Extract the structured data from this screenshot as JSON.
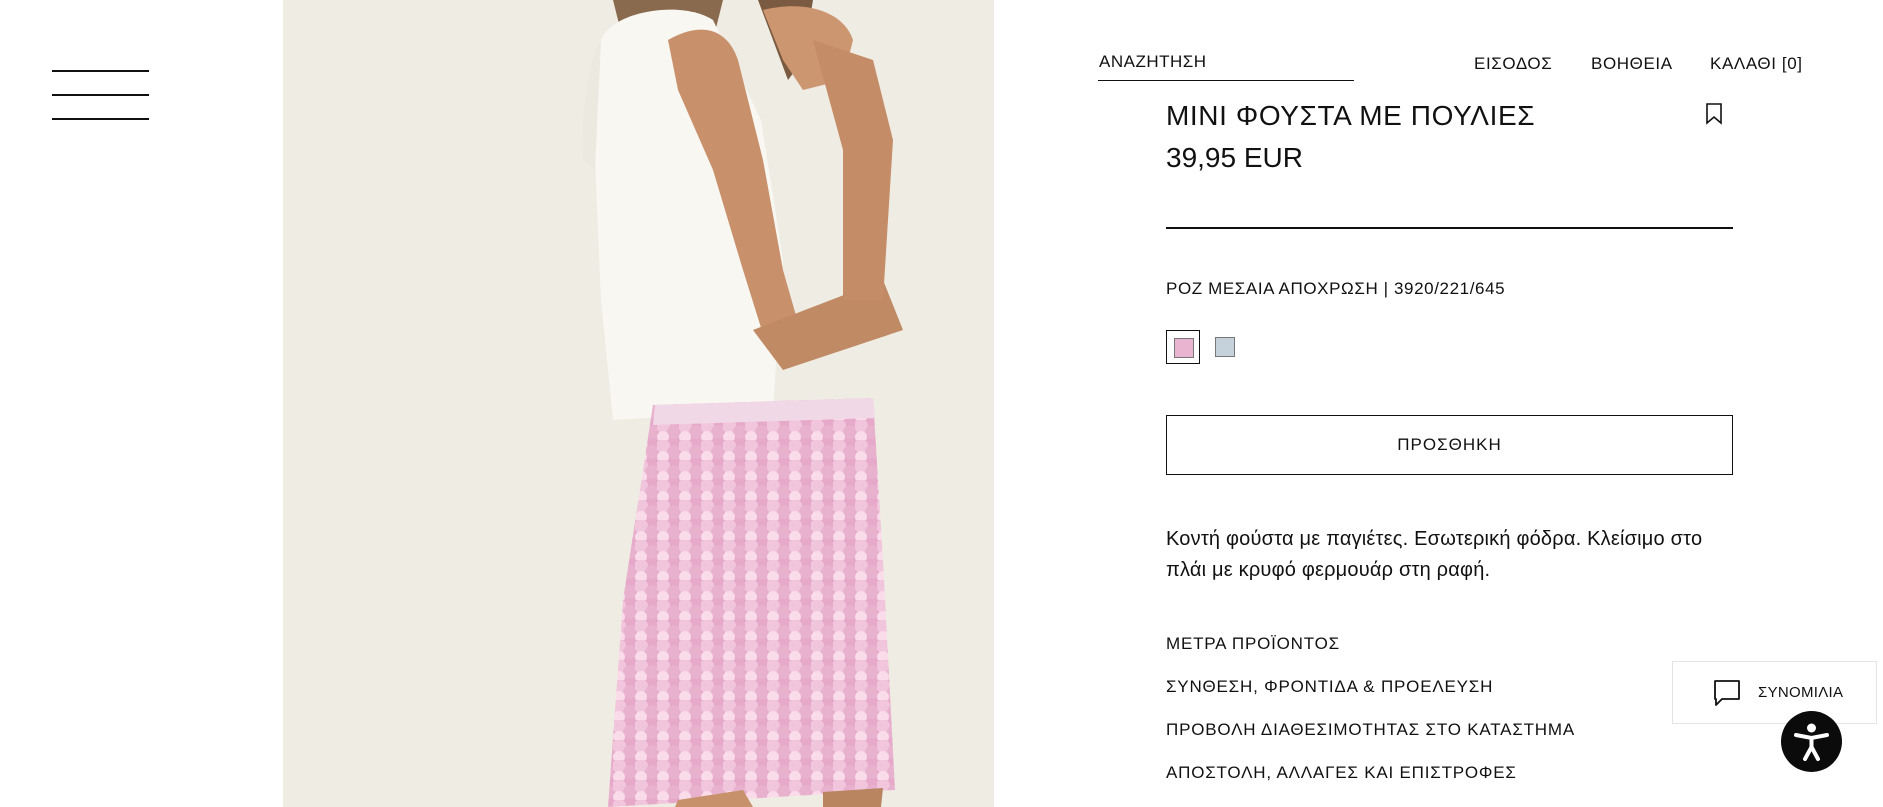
{
  "header": {
    "search_label": "ΑΝΑΖΗΤΗΣΗ",
    "login": "ΕΙΣΟΔΟΣ",
    "help": "ΒΟΗΘΕΙΑ",
    "cart": "ΚΑΛΑΘΙ [0]"
  },
  "product": {
    "title": "ΜΙΝΙ ΦΟΥΣΤΑ ΜΕ ΠΟΥΛΙΕΣ",
    "price": "39,95 EUR",
    "color_ref": "ΡΟΖ ΜΕΣΑΙΑ ΑΠΟΧΡΩΣΗ | 3920/221/645",
    "colors": [
      {
        "name": "pink",
        "hex": "#e9b4d0",
        "selected": true
      },
      {
        "name": "light-blue",
        "hex": "#c5d2dc",
        "selected": false
      }
    ],
    "add_label": "ΠΡΟΣΘΗΚΗ",
    "description": "Κοντή φούστα με παγιέτες. Εσωτερική φόδρα. Κλείσιμο στο πλάι με κρυφό φερμουάρ στη ραφή.",
    "links": [
      "ΜΕΤΡΑ ΠΡΟΪΟΝΤΟΣ",
      "ΣΥΝΘΕΣΗ, ΦΡΟΝΤΙΔΑ & ΠΡΟΕΛΕΥΣΗ",
      "ΠΡΟΒΟΛΗ ΔΙΑΘΕΣΙΜΟΤΗΤΑΣ ΣΤΟ ΚΑΤΑΣΤΗΜΑ",
      "ΑΠΟΣΤΟΛΗ, ΑΛΛΑΓΕΣ ΚΑΙ ΕΠΙΣΤΡΟΦΕΣ"
    ]
  },
  "chat": {
    "label": "ΣΥΝΟΜΙΛΙΑ"
  },
  "icons": {
    "menu": "hamburger-icon",
    "bookmark": "bookmark-icon",
    "chat": "chat-bubble-icon",
    "accessibility": "accessibility-icon"
  }
}
